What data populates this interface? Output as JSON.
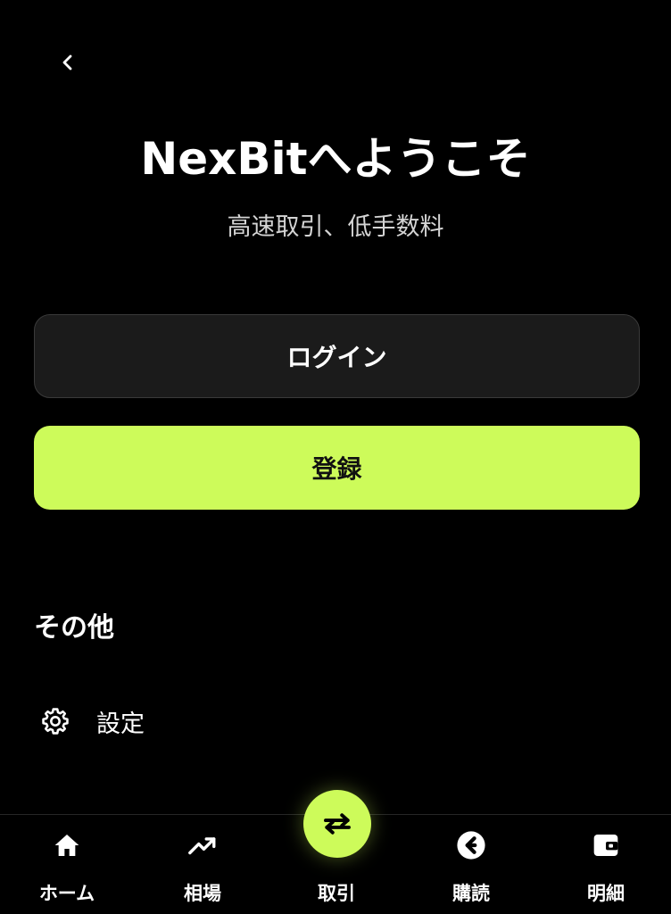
{
  "header": {
    "back_icon": "chevron-left-icon"
  },
  "welcome": {
    "title": "NexBitへようこそ",
    "subtitle": "高速取引、低手数料"
  },
  "actions": {
    "login_label": "ログイン",
    "register_label": "登録"
  },
  "other": {
    "section_title": "その他",
    "settings_label": "設定",
    "settings_icon": "gear-icon"
  },
  "tabbar": {
    "tabs": [
      {
        "label": "ホーム",
        "icon": "home-icon"
      },
      {
        "label": "相場",
        "icon": "trending-up-icon"
      },
      {
        "label": "取引",
        "icon": "swap-arrows-icon"
      },
      {
        "label": "購読",
        "icon": "subscribe-icon"
      },
      {
        "label": "明細",
        "icon": "wallet-icon"
      }
    ]
  },
  "colors": {
    "background": "#000000",
    "accent": "#cdfb5a",
    "login_button_bg": "#1b1b1b",
    "subtitle_text": "#d4d4d4"
  }
}
